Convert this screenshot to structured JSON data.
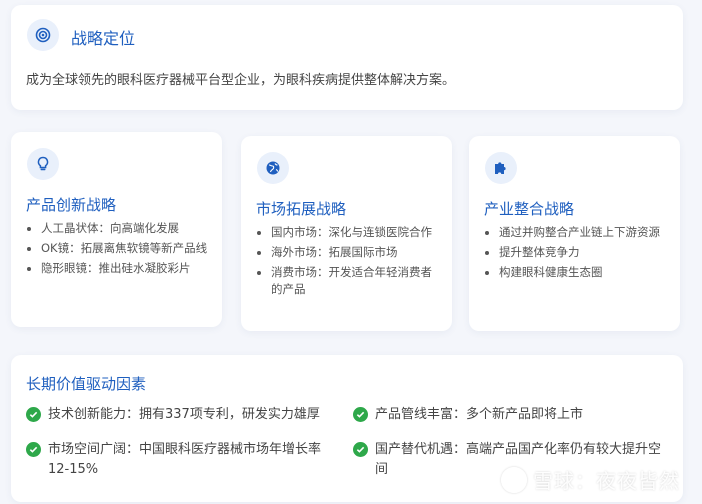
{
  "strategy": {
    "icon": "target-icon",
    "title": "战略定位",
    "description": "成为全球领先的眼科医疗器械平台型企业，为眼科疾病提供整体解决方案。"
  },
  "cards": [
    {
      "icon": "lightbulb-icon",
      "title": "产品创新战略",
      "items": [
        "人工晶状体：向高端化发展",
        "OK镜：拓展离焦软镜等新产品线",
        "隐形眼镜：推出硅水凝胶彩片"
      ]
    },
    {
      "icon": "globe-icon",
      "title": "市场拓展战略",
      "items": [
        "国内市场：深化与连锁医院合作",
        "海外市场：拓展国际市场",
        "消费市场：开发适合年轻消费者的产品"
      ]
    },
    {
      "icon": "puzzle-icon",
      "title": "产业整合战略",
      "items": [
        "通过并购整合产业链上下游资源",
        "提升整体竞争力",
        "构建眼科健康生态圈"
      ]
    }
  ],
  "value": {
    "title": "长期价值驱动因素",
    "items": [
      "技术创新能力：拥有337项专利，研发实力雄厚",
      "产品管线丰富：多个新产品即将上市",
      "市场空间广阔：中国眼科医疗器械市场年增长率12-15%",
      "国产替代机遇：高端产品国产化率仍有较大提升空间"
    ]
  },
  "watermark": "雪球：夜夜皆然",
  "colors": {
    "accent": "#1f5fbf",
    "icon_bg": "#e9f0fb",
    "check": "#2ea84a"
  }
}
